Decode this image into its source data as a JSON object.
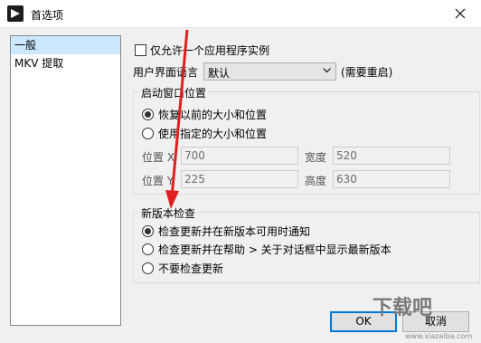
{
  "window": {
    "title": "首选项"
  },
  "sidebar": {
    "items": [
      {
        "label": "一般",
        "selected": true
      },
      {
        "label": "MKV 提取",
        "selected": false
      }
    ]
  },
  "general": {
    "single_instance_label": "仅允许一个应用程序实例",
    "single_instance_checked": false,
    "ui_language_label": "用户界面语言",
    "ui_language_value": "默认",
    "restart_note": "(需要重启)"
  },
  "startup_position": {
    "title": "启动窗口位置",
    "options": [
      {
        "label": "恢复以前的大小和位置",
        "checked": true
      },
      {
        "label": "使用指定的大小和位置",
        "checked": false
      }
    ],
    "pos_x_label": "位置 X",
    "pos_x_value": "700",
    "width_label": "宽度",
    "width_value": "520",
    "pos_y_label": "位置 Y",
    "pos_y_value": "225",
    "height_label": "高度",
    "height_value": "630"
  },
  "update_check": {
    "title": "新版本检查",
    "options": [
      {
        "label": "检查更新并在新版本可用时通知",
        "checked": true
      },
      {
        "label": "检查更新并在帮助 > 关于对话框中显示最新版本",
        "checked": false
      },
      {
        "label": "不要检查更新",
        "checked": false
      }
    ]
  },
  "buttons": {
    "ok": "OK",
    "cancel": "取消"
  },
  "watermark": {
    "text": "下载吧",
    "url": "www.xiazaiba.com"
  },
  "colors": {
    "arrow": "#e02020",
    "selection": "#cce8ff",
    "accent": "#0078d7"
  }
}
